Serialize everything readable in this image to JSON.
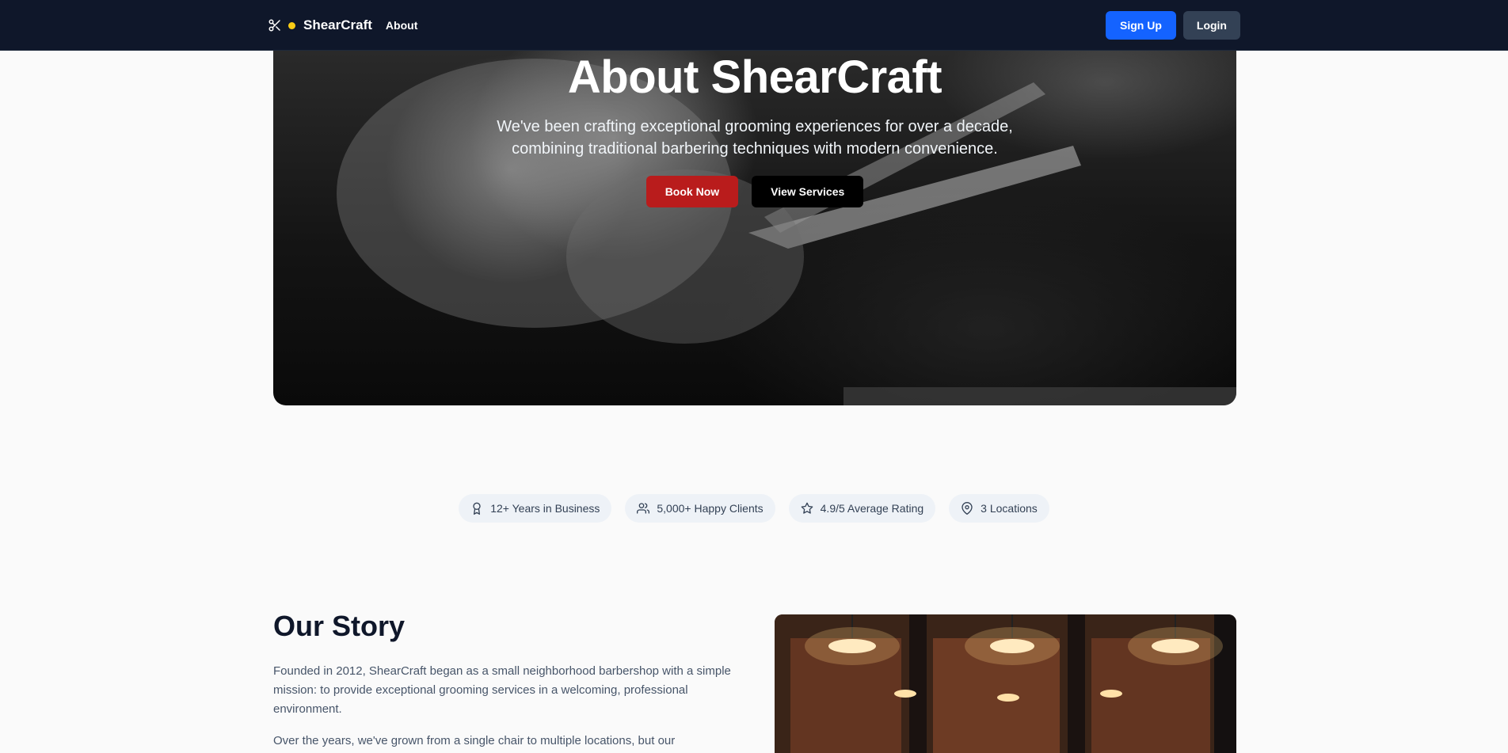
{
  "nav": {
    "brand": "ShearCraft",
    "links": [
      "About"
    ],
    "signup_label": "Sign Up",
    "login_label": "Login"
  },
  "hero": {
    "title": "About ShearCraft",
    "subtitle_line1": "We've been crafting exceptional grooming experiences for over a decade,",
    "subtitle_line2": "combining traditional barbering techniques with modern convenience.",
    "book_label": "Book Now",
    "services_label": "View Services"
  },
  "stats": [
    {
      "icon": "award-icon",
      "label": "12+ Years in Business"
    },
    {
      "icon": "users-icon",
      "label": "5,000+ Happy Clients"
    },
    {
      "icon": "star-icon",
      "label": "4.9/5 Average Rating"
    },
    {
      "icon": "map-pin-icon",
      "label": "3 Locations"
    }
  ],
  "story": {
    "title": "Our Story",
    "p1": "Founded in 2012, ShearCraft began as a small neighborhood barbershop with a simple mission: to provide exceptional grooming services in a welcoming, professional environment.",
    "p2": "Over the years, we've grown from a single chair to multiple locations, but our"
  },
  "colors": {
    "nav_bg": "#0f172a",
    "brand_dot": "#facc15",
    "signup": "#1463ff",
    "login": "#334155",
    "book": "#b91c1c"
  }
}
